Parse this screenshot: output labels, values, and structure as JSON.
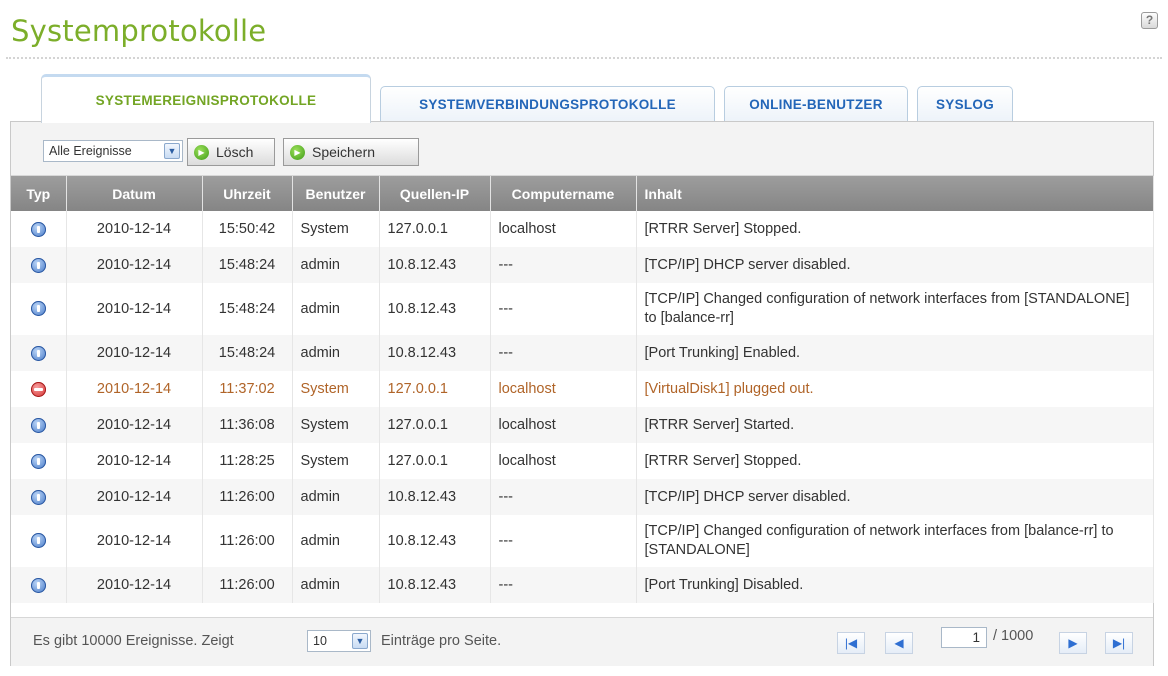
{
  "page": {
    "title": "Systemprotokolle"
  },
  "tabs": [
    {
      "label": "SYSTEMEREIGNISPROTOKOLLE",
      "active": true
    },
    {
      "label": "SYSTEMVERBINDUNGSPROTOKOLLE",
      "active": false
    },
    {
      "label": "ONLINE-BENUTZER",
      "active": false
    },
    {
      "label": "SYSLOG",
      "active": false
    }
  ],
  "toolbar": {
    "filter_value": "Alle Ereignisse",
    "delete_label": "Lösch",
    "save_label": "Speichern"
  },
  "table": {
    "columns": [
      "Typ",
      "Datum",
      "Uhrzeit",
      "Benutzer",
      "Quellen-IP",
      "Computername",
      "Inhalt"
    ],
    "rows": [
      {
        "type": "info",
        "date": "2010-12-14",
        "time": "15:50:42",
        "user": "System",
        "ip": "127.0.0.1",
        "computer": "localhost",
        "content": "[RTRR Server] Stopped."
      },
      {
        "type": "info",
        "date": "2010-12-14",
        "time": "15:48:24",
        "user": "admin",
        "ip": "10.8.12.43",
        "computer": "---",
        "content": "[TCP/IP] DHCP server disabled."
      },
      {
        "type": "info",
        "date": "2010-12-14",
        "time": "15:48:24",
        "user": "admin",
        "ip": "10.8.12.43",
        "computer": "---",
        "content": "[TCP/IP] Changed configuration of network interfaces from [STANDALONE] to [balance-rr]"
      },
      {
        "type": "info",
        "date": "2010-12-14",
        "time": "15:48:24",
        "user": "admin",
        "ip": "10.8.12.43",
        "computer": "---",
        "content": "[Port Trunking] Enabled."
      },
      {
        "type": "error",
        "date": "2010-12-14",
        "time": "11:37:02",
        "user": "System",
        "ip": "127.0.0.1",
        "computer": "localhost",
        "content": "[VirtualDisk1] plugged out."
      },
      {
        "type": "info",
        "date": "2010-12-14",
        "time": "11:36:08",
        "user": "System",
        "ip": "127.0.0.1",
        "computer": "localhost",
        "content": "[RTRR Server] Started."
      },
      {
        "type": "info",
        "date": "2010-12-14",
        "time": "11:28:25",
        "user": "System",
        "ip": "127.0.0.1",
        "computer": "localhost",
        "content": "[RTRR Server] Stopped."
      },
      {
        "type": "info",
        "date": "2010-12-14",
        "time": "11:26:00",
        "user": "admin",
        "ip": "10.8.12.43",
        "computer": "---",
        "content": "[TCP/IP] DHCP server disabled."
      },
      {
        "type": "info",
        "date": "2010-12-14",
        "time": "11:26:00",
        "user": "admin",
        "ip": "10.8.12.43",
        "computer": "---",
        "content": "[TCP/IP] Changed configuration of network interfaces from [balance-rr] to [STANDALONE]"
      },
      {
        "type": "info",
        "date": "2010-12-14",
        "time": "11:26:00",
        "user": "admin",
        "ip": "10.8.12.43",
        "computer": "---",
        "content": "[Port Trunking] Disabled."
      }
    ]
  },
  "footer": {
    "summary": "Es gibt 10000 Ereignisse. Zeigt",
    "per_page_value": "10",
    "per_page_suffix": "Einträge pro Seite.",
    "current_page": "1",
    "total_pages": "/ 1000"
  },
  "colors": {
    "title_green": "#7cae2a",
    "tab_blue": "#2366b8",
    "header_gray": "#8f8f8f",
    "error_text": "#b06428"
  },
  "icons": {
    "help": "help-icon",
    "info": "info-icon",
    "error": "error-icon",
    "go": "go-icon",
    "first": "first-page-icon",
    "prev": "previous-page-icon",
    "next": "next-page-icon",
    "last": "last-page-icon"
  }
}
